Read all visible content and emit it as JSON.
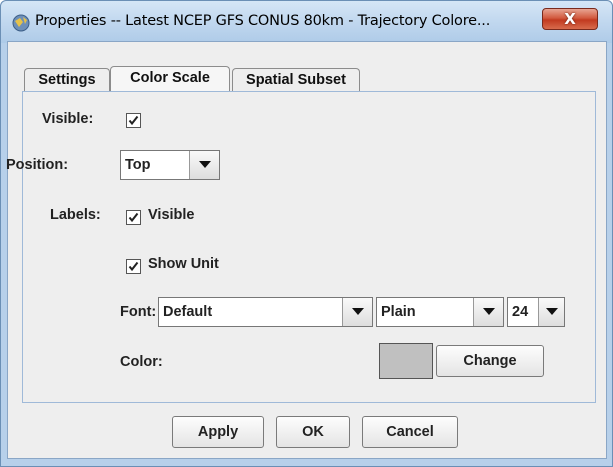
{
  "window": {
    "title": "Properties -- Latest NCEP GFS CONUS 80km - Trajectory Colore...",
    "close_label": "X"
  },
  "tabs": [
    {
      "label": "Settings",
      "active": false
    },
    {
      "label": "Color Scale",
      "active": true
    },
    {
      "label": "Spatial Subset",
      "active": false
    }
  ],
  "color_scale": {
    "visible_label": "Visible:",
    "visible_checked": true,
    "position_label": "Position:",
    "position_value": "Top",
    "labels_label": "Labels:",
    "labels_visible_label": "Visible",
    "labels_visible_checked": true,
    "show_unit_label": "Show Unit",
    "show_unit_checked": true,
    "font_label": "Font:",
    "font_value": "Default",
    "style_value": "Plain",
    "size_value": "24",
    "color_label": "Color:",
    "color_value": "#c0c0c0",
    "change_label": "Change"
  },
  "footer": {
    "apply_label": "Apply",
    "ok_label": "OK",
    "cancel_label": "Cancel"
  }
}
